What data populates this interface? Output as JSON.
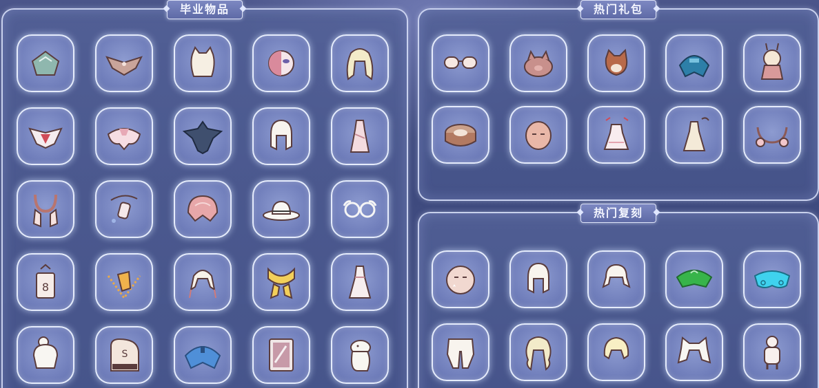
{
  "panels": {
    "graduation": {
      "title": "毕业物品",
      "items": [
        {
          "icon": "teal-cape-icon"
        },
        {
          "icon": "feather-wing-cape-icon"
        },
        {
          "icon": "cat-ear-hair-icon"
        },
        {
          "icon": "half-mask-icon"
        },
        {
          "icon": "long-blonde-hair-icon"
        },
        {
          "icon": "jeweled-cape-icon"
        },
        {
          "icon": "pink-petal-cape-icon"
        },
        {
          "icon": "dark-bat-cape-icon"
        },
        {
          "icon": "white-bob-hair-icon"
        },
        {
          "icon": "pink-dress-icon"
        },
        {
          "icon": "u-scarf-icon"
        },
        {
          "icon": "hair-ornament-icon"
        },
        {
          "icon": "coral-shell-cape-icon"
        },
        {
          "icon": "cowboy-hat-icon"
        },
        {
          "icon": "round-glasses-icon"
        },
        {
          "icon": "lantern-prop-icon"
        },
        {
          "icon": "golden-chain-necklace-icon"
        },
        {
          "icon": "twin-tail-hair-icon"
        },
        {
          "icon": "gold-bow-cape-icon"
        },
        {
          "icon": "white-gown-icon"
        },
        {
          "icon": "bun-hair-icon"
        },
        {
          "icon": "piano-prop-icon"
        },
        {
          "icon": "blue-cape-icon"
        },
        {
          "icon": "card-prop-icon"
        },
        {
          "icon": "moomin-icon"
        }
      ]
    },
    "hot_packs": {
      "title": "热门礼包",
      "items": [
        {
          "icon": "sunglasses-icon"
        },
        {
          "icon": "pig-mask-icon"
        },
        {
          "icon": "red-panda-icon"
        },
        {
          "icon": "blue-hood-cape-icon"
        },
        {
          "icon": "bunny-doll-icon"
        },
        {
          "icon": "round-cake-icon"
        },
        {
          "icon": "face-mask-icon"
        },
        {
          "icon": "lolita-dress-set-icon"
        },
        {
          "icon": "cream-dress-set-icon"
        },
        {
          "icon": "flower-necklace-icon"
        }
      ]
    },
    "hot_reprints": {
      "title": "热门复刻",
      "items": [
        {
          "icon": "star-face-mask-icon"
        },
        {
          "icon": "white-bob-hair-icon"
        },
        {
          "icon": "side-ponytail-hair-icon"
        },
        {
          "icon": "green-leaf-cape-icon"
        },
        {
          "icon": "cyan-cloud-cape-icon"
        },
        {
          "icon": "puffy-pants-icon"
        },
        {
          "icon": "wavy-long-hair-icon"
        },
        {
          "icon": "short-blonde-hair-icon"
        },
        {
          "icon": "cat-hood-icon"
        },
        {
          "icon": "bear-outfit-icon"
        }
      ]
    }
  },
  "colors": {
    "panel_border": "#e1e8ff",
    "slot_fill": "#7886c0",
    "title_bg": "#6e79b6"
  }
}
